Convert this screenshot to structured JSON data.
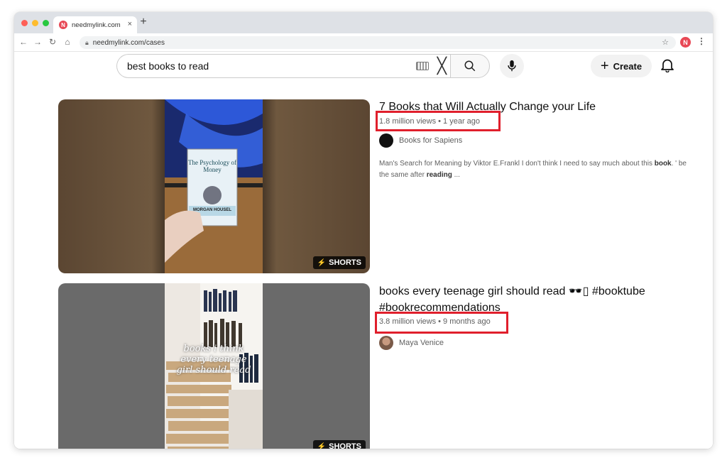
{
  "browser": {
    "tab_title": "needmylink.com",
    "favicon_letter": "N",
    "tab_close": "×",
    "new_tab": "+",
    "url": "needmylink.com/cases",
    "profile_letter": "N"
  },
  "header": {
    "search_query": "best books to read",
    "create_label": "Create"
  },
  "results": [
    {
      "title": "7 Books that Will Actually Change your Life",
      "meta": "1.8 million views • 1 year ago",
      "channel": "Books for Sapiens",
      "snippet_parts": [
        "Man's Search for Meaning by Viktor E.Frankl I don't think I need to say much about this ",
        "book",
        ". ' be the same after ",
        "reading",
        " ..."
      ],
      "badge": "SHORTS",
      "thumb_book_title": "The Psychology of Money",
      "thumb_author": "MORGAN HOUSEL"
    },
    {
      "title": "books every teenage girl should read 🕶️▯ #booktube #bookrecommendations",
      "meta": "3.8 million views • 9 months ago",
      "channel": "Maya Venice",
      "badge": "SHORTS",
      "thumb_overlay_text": "books i think every teenage girl should read"
    }
  ],
  "colors": {
    "highlight": "#e01f2c",
    "brand": "#e84855"
  }
}
